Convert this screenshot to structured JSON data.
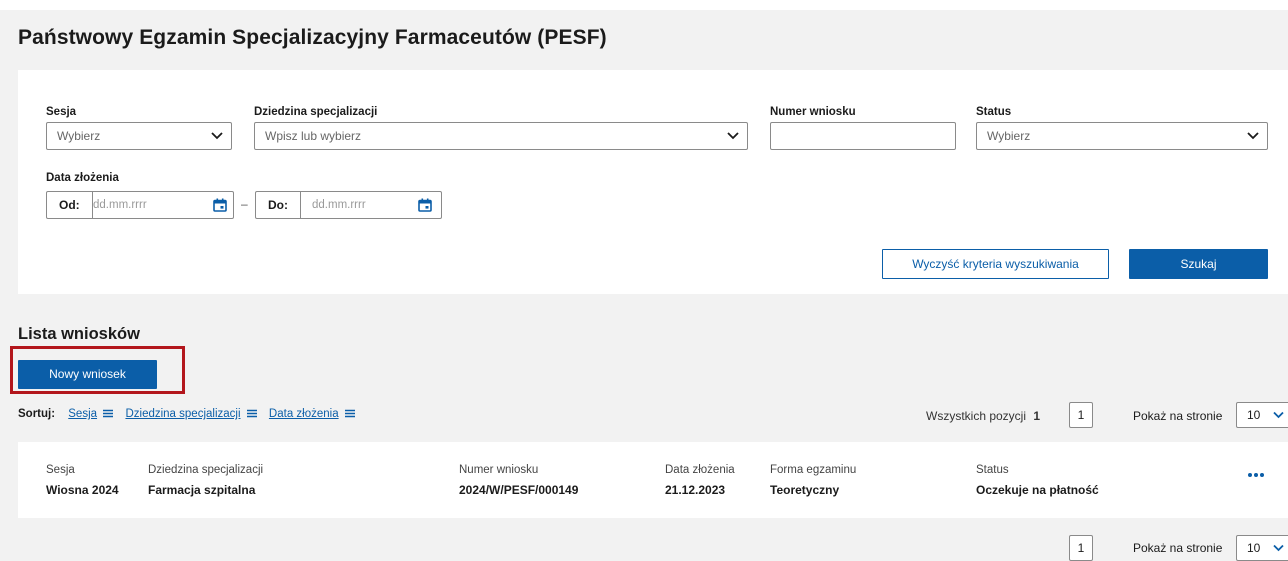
{
  "page_title": "Państwowy Egzamin Specjalizacyjny Farmaceutów (PESF)",
  "filters": {
    "sesja": {
      "label": "Sesja",
      "placeholder": "Wybierz"
    },
    "dziedzina": {
      "label": "Dziedzina specjalizacji",
      "placeholder": "Wpisz lub wybierz"
    },
    "numer": {
      "label": "Numer wniosku",
      "value": ""
    },
    "status": {
      "label": "Status",
      "placeholder": "Wybierz"
    },
    "data": {
      "label": "Data złożenia",
      "od_label": "Od:",
      "do_label": "Do:",
      "placeholder": "dd.mm.rrrr",
      "separator": "–"
    },
    "clear_label": "Wyczyść kryteria wyszukiwania",
    "search_label": "Szukaj"
  },
  "list": {
    "heading": "Lista wniosków",
    "new_button": "Nowy wniosek",
    "sort_label": "Sortuj:",
    "sort_options": [
      "Sesja",
      "Dziedzina specjalizacji",
      "Data złożenia"
    ],
    "total_label": "Wszystkich pozycji",
    "total_count": "1",
    "page": "1",
    "per_page_label": "Pokaż na stronie",
    "per_page": "10",
    "columns": [
      "Sesja",
      "Dziedzina specjalizacji",
      "Numer wniosku",
      "Data złożenia",
      "Forma egzaminu",
      "Status"
    ],
    "rows": [
      [
        "Wiosna 2024",
        "Farmacja szpitalna",
        "2024/W/PESF/000149",
        "21.12.2023",
        "Teoretyczny",
        "Oczekuje na płatność"
      ]
    ]
  },
  "colors": {
    "accent": "#0b5ea8",
    "highlight": "#b3161c",
    "background": "#f2f2f2"
  },
  "icons": [
    "chevron-down-icon",
    "calendar-icon",
    "sort-icon",
    "more-icon"
  ]
}
